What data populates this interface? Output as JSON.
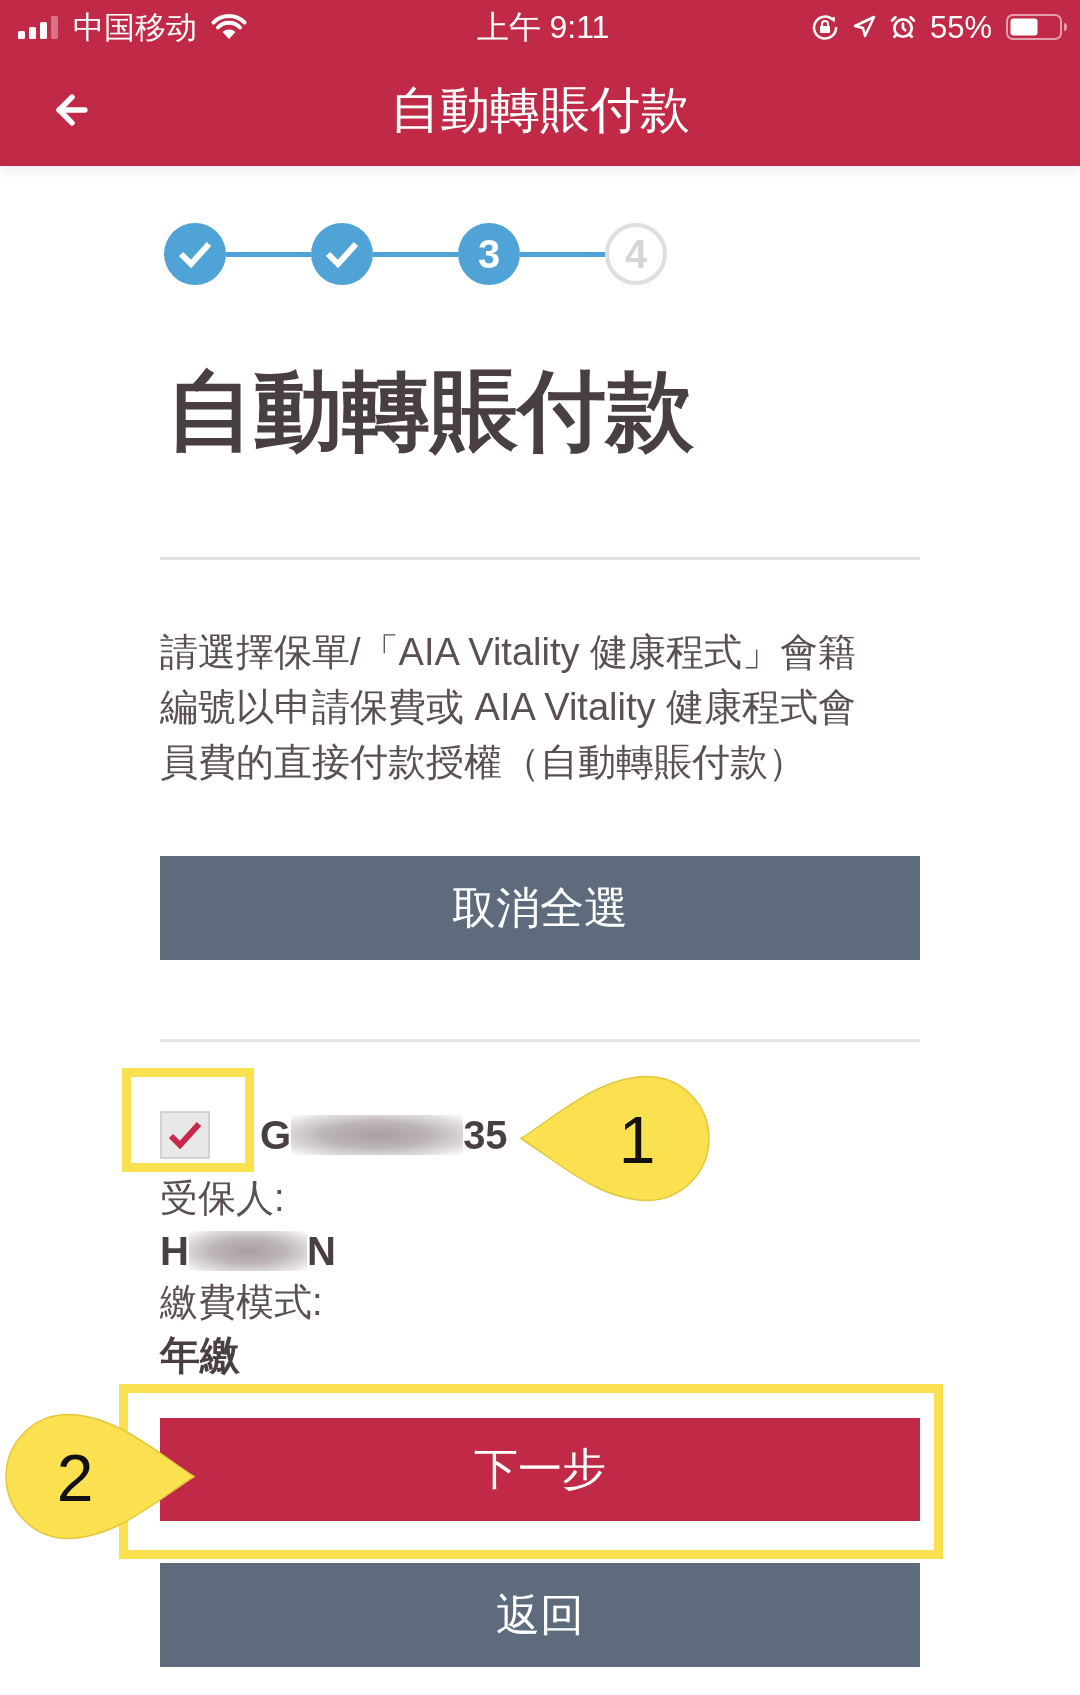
{
  "status_bar": {
    "carrier": "中国移动",
    "time": "上午 9:11",
    "battery": "55%"
  },
  "header": {
    "title": "自動轉賬付款"
  },
  "stepper": [
    {
      "kind": "done"
    },
    {
      "kind": "done"
    },
    {
      "kind": "current",
      "number": "3"
    },
    {
      "kind": "upcoming",
      "number": "4"
    }
  ],
  "page_title": "自動轉賬付款",
  "instructions": [
    "請選擇保單/「AIA Vitality 健康程式」會籍",
    "編號以申請保費或 AIA Vitality 健康程式會",
    "員費的直接付款授權（自動轉賬付款）"
  ],
  "deselect_all_button": {
    "label": "取消全選"
  },
  "policies": [
    {
      "checked": true,
      "number_start": "G",
      "number_end": "35",
      "insured_label": "受保人:",
      "insured_start": "H",
      "insured_end": "N",
      "payment_mode_label": "繳費模式:",
      "payment_mode": "年繳",
      "annotation": {
        "number": "1"
      }
    }
  ],
  "buttons": [
    {
      "kind": "primary",
      "label": "下一步",
      "annotation": {
        "number": "2"
      }
    },
    {
      "kind": "secondary",
      "label": "返回"
    }
  ]
}
